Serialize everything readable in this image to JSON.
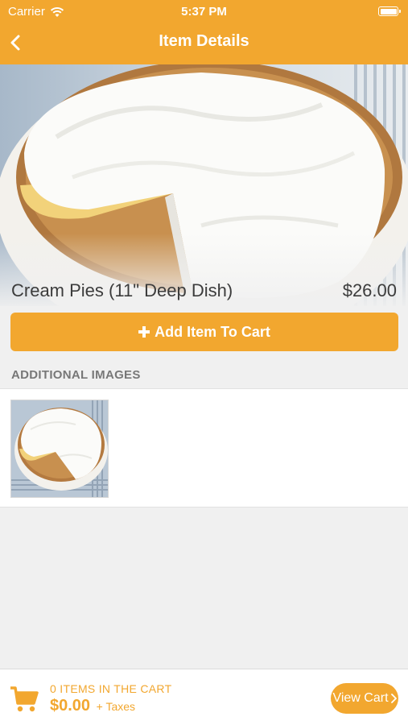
{
  "status_bar": {
    "carrier": "Carrier",
    "time": "5:37 PM"
  },
  "nav": {
    "title": "Item Details",
    "back_icon": "chevron-left-icon"
  },
  "item": {
    "name": "Cream Pies (11\" Deep Dish)",
    "price": "$26.00"
  },
  "add_button": {
    "label": "Add Item To Cart",
    "icon": "plus-icon"
  },
  "additional_images": {
    "header": "ADDITIONAL IMAGES"
  },
  "cart": {
    "count_text": "0 ITEMS IN THE CART",
    "total": "$0.00",
    "taxes_text": "+ Taxes",
    "view_cart_label": "View Cart",
    "view_cart_icon": "chevron-right-icon"
  },
  "colors": {
    "accent": "#f2a72f",
    "background": "#f0f0f0"
  }
}
